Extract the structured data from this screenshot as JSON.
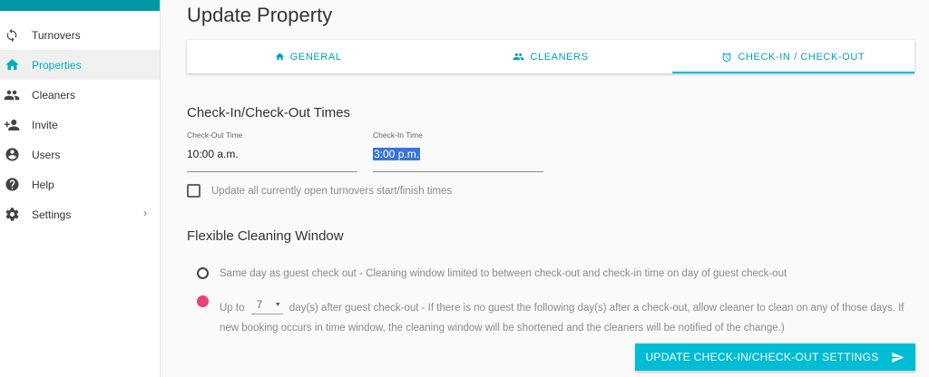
{
  "sidebar": {
    "items": [
      {
        "label": "Turnovers",
        "icon": "sync-icon"
      },
      {
        "label": "Properties",
        "icon": "home-icon",
        "active": true
      },
      {
        "label": "Cleaners",
        "icon": "people-icon"
      },
      {
        "label": "Invite",
        "icon": "person-add-icon"
      },
      {
        "label": "Users",
        "icon": "account-circle-icon"
      },
      {
        "label": "Help",
        "icon": "help-icon"
      },
      {
        "label": "Settings",
        "icon": "gear-icon",
        "has_submenu": true
      }
    ]
  },
  "page": {
    "title": "Update Property"
  },
  "tabs": [
    {
      "label": "GENERAL",
      "icon": "home-icon"
    },
    {
      "label": "CLEANERS",
      "icon": "people-icon"
    },
    {
      "label": "CHECK-IN / CHECK-OUT",
      "icon": "alarm-clock-icon",
      "active": true
    }
  ],
  "times": {
    "section_title": "Check-In/Check-Out Times",
    "checkout_label": "Check-Out Time",
    "checkout_value": "10:00 a.m.",
    "checkin_label": "Check-In Time",
    "checkin_value": "3:00 p.m.",
    "update_open_label": "Update all currently open turnovers start/finish times",
    "update_open_checked": false
  },
  "window": {
    "section_title": "Flexible Cleaning Window",
    "option_same_day": "Same day as guest check out - Cleaning window limited to between check-out and check-in time on day of guest check-out",
    "option_up_to_prefix": "Up to",
    "option_days_value": "7",
    "option_up_to_suffix": "day(s) after guest check-out - If there is no guest the following day(s) after a check-out, allow cleaner to clean on any of those days. If",
    "option_up_to_line2": "new booking occurs in time window, the cleaning window will be shortened and the cleaners will be notified of the change.)",
    "selected": "up_to"
  },
  "submit_label": "UPDATE CHECK-IN/CHECK-OUT SETTINGS",
  "colors": {
    "accent": "#00bcd4",
    "radio_selected": "#ec407a",
    "header_bar": "#0097a7"
  }
}
